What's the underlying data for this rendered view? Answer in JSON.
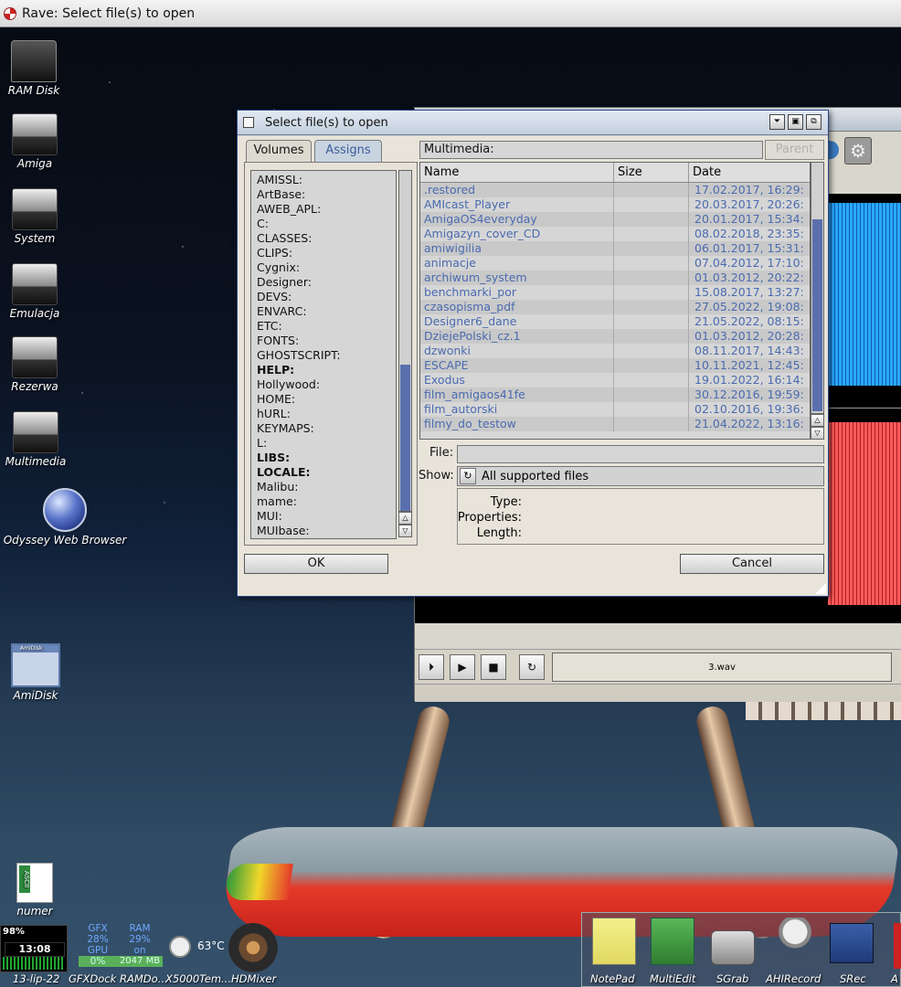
{
  "screen": {
    "title": "Rave: Select file(s) to open"
  },
  "desktop_icons": [
    {
      "label": "RAM Disk",
      "icon": "ram-disk-icon"
    },
    {
      "label": "Amiga",
      "icon": "hard-drive-tools-icon"
    },
    {
      "label": "System",
      "icon": "boing-ball-drive-icon"
    },
    {
      "label": "Emulacja",
      "icon": "gamepad-drive-icon"
    },
    {
      "label": "Rezerwa",
      "icon": "wrench-drive-icon"
    },
    {
      "label": "Multimedia",
      "icon": "film-reel-drive-icon"
    },
    {
      "label": "Odyssey Web Browser",
      "icon": "globe-icon"
    },
    {
      "label": "AmiDisk",
      "icon": "amidisk-icon",
      "window_label": "AmiDisk"
    },
    {
      "label": "numer",
      "icon": "ascii-document-icon",
      "tag": "ASCII"
    }
  ],
  "dialog": {
    "title": "Select file(s) to open",
    "tabs": [
      {
        "label": "Volumes",
        "active": false
      },
      {
        "label": "Assigns",
        "active": true
      }
    ],
    "assigns": [
      {
        "name": "AMISSL:",
        "bold": false
      },
      {
        "name": "ArtBase:",
        "bold": false
      },
      {
        "name": "AWEB_APL:",
        "bold": false
      },
      {
        "name": "C:",
        "bold": false
      },
      {
        "name": "CLASSES:",
        "bold": false
      },
      {
        "name": "CLIPS:",
        "bold": false
      },
      {
        "name": "Cygnix:",
        "bold": false
      },
      {
        "name": "Designer:",
        "bold": false
      },
      {
        "name": "DEVS:",
        "bold": false
      },
      {
        "name": "ENVARC:",
        "bold": false
      },
      {
        "name": "ETC:",
        "bold": false
      },
      {
        "name": "FONTS:",
        "bold": false
      },
      {
        "name": "GHOSTSCRIPT:",
        "bold": false
      },
      {
        "name": "HELP:",
        "bold": true
      },
      {
        "name": "Hollywood:",
        "bold": false
      },
      {
        "name": "HOME:",
        "bold": false
      },
      {
        "name": "hURL:",
        "bold": false
      },
      {
        "name": "KEYMAPS:",
        "bold": false
      },
      {
        "name": "L:",
        "bold": false
      },
      {
        "name": "LIBS:",
        "bold": true
      },
      {
        "name": "LOCALE:",
        "bold": true
      },
      {
        "name": "Malibu:",
        "bold": false
      },
      {
        "name": "mame:",
        "bold": false
      },
      {
        "name": "MUI:",
        "bold": false
      },
      {
        "name": "MUIbase:",
        "bold": false
      }
    ],
    "path": "Multimedia:",
    "parent_label": "Parent",
    "columns": {
      "name": "Name",
      "size": "Size",
      "date": "Date"
    },
    "files": [
      {
        "name": ".restored",
        "size": "",
        "date": "17.02.2017, 16:29:"
      },
      {
        "name": "AMIcast_Player",
        "size": "",
        "date": "20.03.2017, 20:26:"
      },
      {
        "name": "AmigaOS4everyday",
        "size": "",
        "date": "20.01.2017, 15:34:"
      },
      {
        "name": "Amigazyn_cover_CD",
        "size": "",
        "date": "08.02.2018, 23:35:"
      },
      {
        "name": "amiwigilia",
        "size": "",
        "date": "06.01.2017, 15:31:"
      },
      {
        "name": "animacje",
        "size": "",
        "date": "07.04.2012, 17:10:"
      },
      {
        "name": "archiwum_system",
        "size": "",
        "date": "01.03.2012, 20:22:"
      },
      {
        "name": "benchmarki_por",
        "size": "",
        "date": "15.08.2017, 13:27:"
      },
      {
        "name": "czasopisma_pdf",
        "size": "",
        "date": "27.05.2022, 19:08:"
      },
      {
        "name": "Designer6_dane",
        "size": "",
        "date": "21.05.2022, 08:15:"
      },
      {
        "name": "DziejePolski_cz.1",
        "size": "",
        "date": "01.03.2012, 20:28:"
      },
      {
        "name": "dzwonki",
        "size": "",
        "date": "08.11.2017, 14:43:"
      },
      {
        "name": "ESCAPE",
        "size": "",
        "date": "10.11.2021, 12:45:"
      },
      {
        "name": "Exodus",
        "size": "",
        "date": "19.01.2022, 16:14:"
      },
      {
        "name": "film_amigaos41fe",
        "size": "",
        "date": "30.12.2016, 19:59:"
      },
      {
        "name": "film_autorski",
        "size": "",
        "date": "02.10.2016, 19:36:"
      },
      {
        "name": "filmy_do_testow",
        "size": "",
        "date": "21.04.2022, 13:16:"
      }
    ],
    "file_label": "File:",
    "file_value": "",
    "show_label": "Show:",
    "show_value": "All supported files",
    "info": {
      "type_label": "Type:",
      "properties_label": "Properties:",
      "length_label": "Length:"
    },
    "ok_label": "OK",
    "cancel_label": "Cancel"
  },
  "rave": {
    "file_display": "3.wav"
  },
  "monitor": {
    "cpu_percent": "98%",
    "clock": "13:08",
    "date": "13-lip-22",
    "gfx": {
      "l1": "GFX",
      "l2": "28%",
      "l3": "GPU",
      "l4": "0%"
    },
    "ram": {
      "l1": "RAM",
      "l2": "29%",
      "l3": "on",
      "l4": "2047 MB"
    },
    "temp": "63°C"
  },
  "dock_left_labels": [
    "GFXDock",
    "RAMDo...",
    "X5000Tem...",
    "HDMixer"
  ],
  "dock_right_labels": [
    "NotePad",
    "MultiEdit",
    "SGrab",
    "AHIRecord",
    "SRec",
    "A"
  ]
}
